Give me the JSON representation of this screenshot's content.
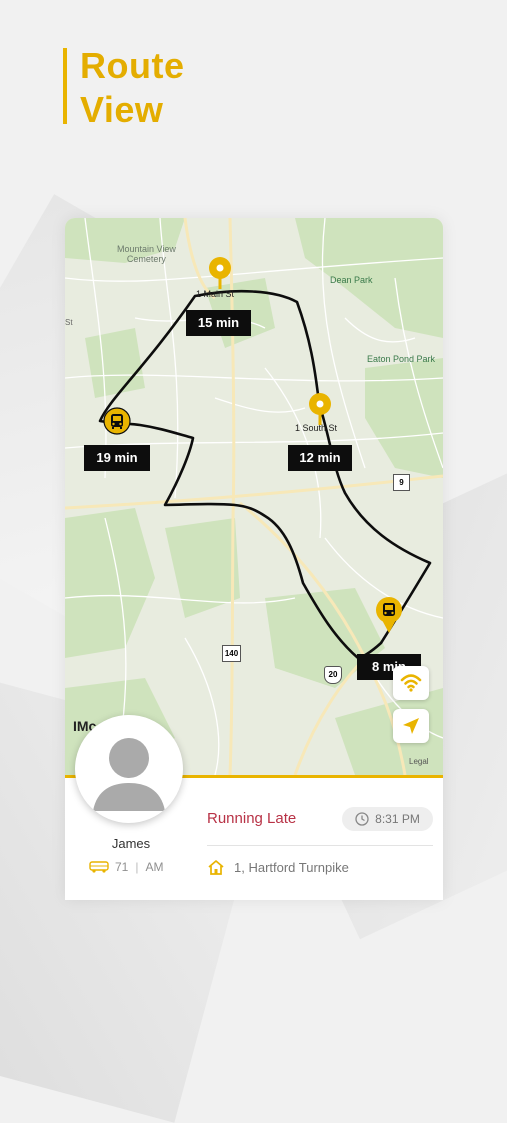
{
  "header": {
    "title_line1": "Route",
    "title_line2": "View"
  },
  "map": {
    "place_labels": {
      "cemetery_line1": "Mountain View",
      "cemetery_line2": "Cemetery",
      "dean_park": "Dean Park",
      "eaton_pond_park": "Eaton Pond Park",
      "street_fragment": "St"
    },
    "stops": [
      {
        "label": "1 Main St",
        "eta": "15 min"
      },
      {
        "label": "1 South St",
        "eta": "12 min"
      }
    ],
    "bus_etas": {
      "current_bus": "19 min",
      "next_bus": "8 min"
    },
    "road_shields": [
      "9",
      "140",
      "20"
    ],
    "brand_fragment": "IMc",
    "legal_label": "Legal"
  },
  "colors": {
    "accent": "#e9b400",
    "status_late": "#b83246",
    "route_line": "#0d0d0d"
  },
  "icons": {
    "stop_pin": "map-pin-icon",
    "bus": "bus-icon",
    "wifi": "wifi-icon",
    "locate": "navigation-arrow-icon",
    "avatar": "user-avatar-icon",
    "clock": "clock-icon",
    "home": "home-icon",
    "route_bus": "bus-small-icon"
  },
  "driver": {
    "name": "James",
    "route_number": "71",
    "shift": "AM"
  },
  "trip": {
    "status": "Running Late",
    "time": "8:31 PM",
    "address": "1, Hartford Turnpike"
  }
}
